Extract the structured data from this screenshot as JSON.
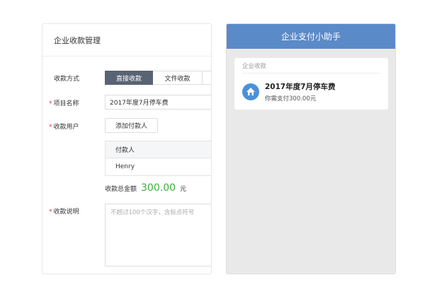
{
  "left_panel": {
    "title": "企业收款管理",
    "method_label": "收款方式",
    "method_tabs": [
      "直接收款",
      "文件收款"
    ],
    "project_label": "项目名称",
    "project_value": "2017年度7月停车费",
    "user_label": "收款用户",
    "add_payer_button": "添加付款人",
    "payer_table": {
      "header": "付款人",
      "rows": [
        "Henry"
      ]
    },
    "total_label": "收款总金额",
    "total_amount": "300.00",
    "total_unit": "元",
    "desc_label": "收款说明",
    "desc_placeholder": "不超过100个汉字，含标点符号",
    "required_mark": "*"
  },
  "right_panel": {
    "header_title": "企业支付小助手",
    "card": {
      "section_title": "企业收款",
      "item_title": "2017年度7月停车费",
      "item_subtitle": "你需支付300.00元"
    }
  },
  "colors": {
    "accent_blue": "#5b8ac8",
    "active_tab": "#5a6373",
    "amount_green": "#3cae3c",
    "required_red": "#e33333"
  },
  "icons": {
    "card_icon": "house-icon"
  }
}
